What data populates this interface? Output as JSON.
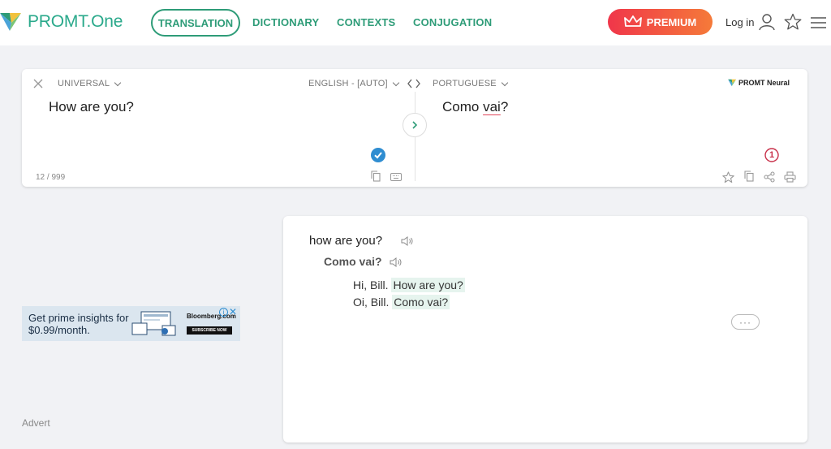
{
  "header": {
    "logo_text": "PROMT.One",
    "nav": {
      "translation": "TRANSLATION",
      "dictionary": "DICTIONARY",
      "contexts": "CONTEXTS",
      "conjugation": "CONJUGATION"
    },
    "premium_label": "PREMIUM",
    "login_label": "Log in",
    "icons": [
      "user-icon",
      "star-icon",
      "menu-icon"
    ]
  },
  "translator": {
    "topic": "UNIVERSAL",
    "source_lang": "ENGLISH - [AUTO]",
    "target_lang": "PORTUGUESE",
    "source_text": "How are you?",
    "target_text_before": "Como ",
    "target_text_underlined": "vai",
    "target_text_after": "?",
    "char_counter": "12 / 999",
    "engine_label": "PROMT Neural",
    "issue_count": "1"
  },
  "result": {
    "query": "how are you?",
    "translation": "Como vai?",
    "examples": [
      {
        "prefix": "Hi, Bill. ",
        "highlight": "How are you?"
      },
      {
        "prefix": "Oi, Bill. ",
        "highlight": "Como vai?"
      }
    ],
    "more_label": "···"
  },
  "ad": {
    "text": "Get prime insights for $0.99/month.",
    "brand": "Bloomberg.com",
    "cta": "SUBSCRIBE NOW",
    "info_glyph": "i",
    "close_glyph": "✕",
    "advert_label": "Advert"
  },
  "colors": {
    "brand_green": "#2e9c78",
    "premium_gradient_start": "#f0364a",
    "premium_gradient_end": "#f57a39",
    "check_blue": "#2f8dd1",
    "issue_red": "#c8304a"
  }
}
